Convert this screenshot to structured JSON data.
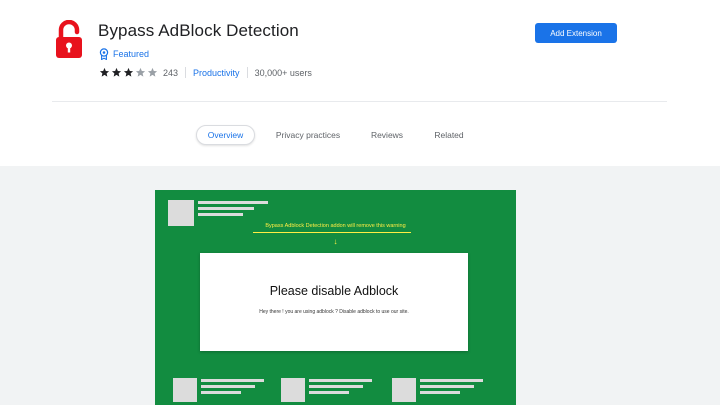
{
  "extension": {
    "title": "Bypass AdBlock Detection",
    "featured_label": "Featured",
    "rating_value": 3,
    "rating_max": 5,
    "rating_count": "243",
    "category": "Productivity",
    "users": "30,000+ users",
    "icon": "unlocked-padlock-icon",
    "icon_color": "#e8121d"
  },
  "actions": {
    "add_label": "Add Extension"
  },
  "tabs": [
    {
      "label": "Overview",
      "active": true
    },
    {
      "label": "Privacy practices",
      "active": false
    },
    {
      "label": "Reviews",
      "active": false
    },
    {
      "label": "Related",
      "active": false
    }
  ],
  "screenshot": {
    "background_color": "#128c40",
    "notice": "Bypass Adblock Detection addon will remove this warning",
    "arrow": "↓",
    "modal_title": "Please disable Adblock",
    "modal_body": "Hey there ! you are using adblock ? Disable adblock to use our site."
  },
  "colors": {
    "accent": "#1a73e8",
    "star": "#202124",
    "star_empty": "#9aa0a6"
  }
}
